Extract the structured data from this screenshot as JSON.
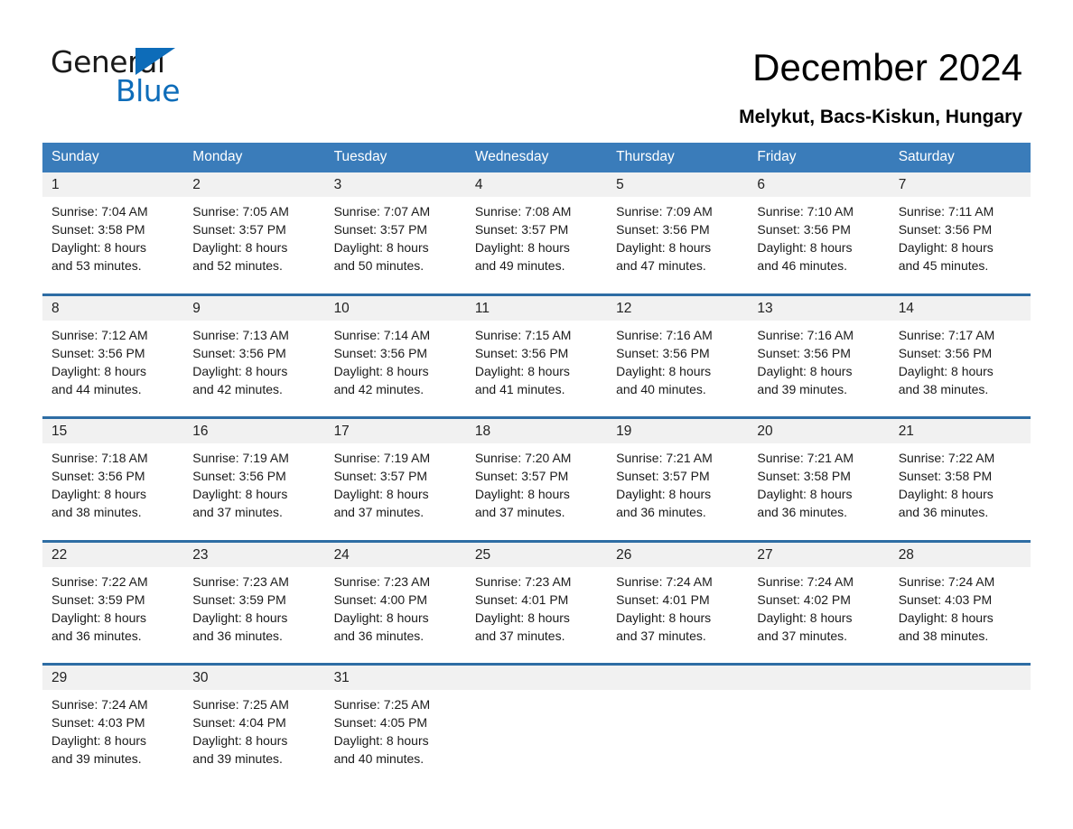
{
  "brand": {
    "name_part1": "General",
    "name_part2": "Blue",
    "accent_color": "#0d6cb9"
  },
  "header": {
    "title": "December 2024",
    "location": "Melykut, Bacs-Kiskun, Hungary"
  },
  "calendar": {
    "header_bg": "#3a7cba",
    "row_border_color": "#2e6da4",
    "daynum_bg": "#f1f1f1",
    "weekday_headers": [
      "Sunday",
      "Monday",
      "Tuesday",
      "Wednesday",
      "Thursday",
      "Friday",
      "Saturday"
    ],
    "weeks": [
      [
        {
          "day": "1",
          "sunrise": "Sunrise: 7:04 AM",
          "sunset": "Sunset: 3:58 PM",
          "daylight_line1": "Daylight: 8 hours",
          "daylight_line2": "and 53 minutes."
        },
        {
          "day": "2",
          "sunrise": "Sunrise: 7:05 AM",
          "sunset": "Sunset: 3:57 PM",
          "daylight_line1": "Daylight: 8 hours",
          "daylight_line2": "and 52 minutes."
        },
        {
          "day": "3",
          "sunrise": "Sunrise: 7:07 AM",
          "sunset": "Sunset: 3:57 PM",
          "daylight_line1": "Daylight: 8 hours",
          "daylight_line2": "and 50 minutes."
        },
        {
          "day": "4",
          "sunrise": "Sunrise: 7:08 AM",
          "sunset": "Sunset: 3:57 PM",
          "daylight_line1": "Daylight: 8 hours",
          "daylight_line2": "and 49 minutes."
        },
        {
          "day": "5",
          "sunrise": "Sunrise: 7:09 AM",
          "sunset": "Sunset: 3:56 PM",
          "daylight_line1": "Daylight: 8 hours",
          "daylight_line2": "and 47 minutes."
        },
        {
          "day": "6",
          "sunrise": "Sunrise: 7:10 AM",
          "sunset": "Sunset: 3:56 PM",
          "daylight_line1": "Daylight: 8 hours",
          "daylight_line2": "and 46 minutes."
        },
        {
          "day": "7",
          "sunrise": "Sunrise: 7:11 AM",
          "sunset": "Sunset: 3:56 PM",
          "daylight_line1": "Daylight: 8 hours",
          "daylight_line2": "and 45 minutes."
        }
      ],
      [
        {
          "day": "8",
          "sunrise": "Sunrise: 7:12 AM",
          "sunset": "Sunset: 3:56 PM",
          "daylight_line1": "Daylight: 8 hours",
          "daylight_line2": "and 44 minutes."
        },
        {
          "day": "9",
          "sunrise": "Sunrise: 7:13 AM",
          "sunset": "Sunset: 3:56 PM",
          "daylight_line1": "Daylight: 8 hours",
          "daylight_line2": "and 42 minutes."
        },
        {
          "day": "10",
          "sunrise": "Sunrise: 7:14 AM",
          "sunset": "Sunset: 3:56 PM",
          "daylight_line1": "Daylight: 8 hours",
          "daylight_line2": "and 42 minutes."
        },
        {
          "day": "11",
          "sunrise": "Sunrise: 7:15 AM",
          "sunset": "Sunset: 3:56 PM",
          "daylight_line1": "Daylight: 8 hours",
          "daylight_line2": "and 41 minutes."
        },
        {
          "day": "12",
          "sunrise": "Sunrise: 7:16 AM",
          "sunset": "Sunset: 3:56 PM",
          "daylight_line1": "Daylight: 8 hours",
          "daylight_line2": "and 40 minutes."
        },
        {
          "day": "13",
          "sunrise": "Sunrise: 7:16 AM",
          "sunset": "Sunset: 3:56 PM",
          "daylight_line1": "Daylight: 8 hours",
          "daylight_line2": "and 39 minutes."
        },
        {
          "day": "14",
          "sunrise": "Sunrise: 7:17 AM",
          "sunset": "Sunset: 3:56 PM",
          "daylight_line1": "Daylight: 8 hours",
          "daylight_line2": "and 38 minutes."
        }
      ],
      [
        {
          "day": "15",
          "sunrise": "Sunrise: 7:18 AM",
          "sunset": "Sunset: 3:56 PM",
          "daylight_line1": "Daylight: 8 hours",
          "daylight_line2": "and 38 minutes."
        },
        {
          "day": "16",
          "sunrise": "Sunrise: 7:19 AM",
          "sunset": "Sunset: 3:56 PM",
          "daylight_line1": "Daylight: 8 hours",
          "daylight_line2": "and 37 minutes."
        },
        {
          "day": "17",
          "sunrise": "Sunrise: 7:19 AM",
          "sunset": "Sunset: 3:57 PM",
          "daylight_line1": "Daylight: 8 hours",
          "daylight_line2": "and 37 minutes."
        },
        {
          "day": "18",
          "sunrise": "Sunrise: 7:20 AM",
          "sunset": "Sunset: 3:57 PM",
          "daylight_line1": "Daylight: 8 hours",
          "daylight_line2": "and 37 minutes."
        },
        {
          "day": "19",
          "sunrise": "Sunrise: 7:21 AM",
          "sunset": "Sunset: 3:57 PM",
          "daylight_line1": "Daylight: 8 hours",
          "daylight_line2": "and 36 minutes."
        },
        {
          "day": "20",
          "sunrise": "Sunrise: 7:21 AM",
          "sunset": "Sunset: 3:58 PM",
          "daylight_line1": "Daylight: 8 hours",
          "daylight_line2": "and 36 minutes."
        },
        {
          "day": "21",
          "sunrise": "Sunrise: 7:22 AM",
          "sunset": "Sunset: 3:58 PM",
          "daylight_line1": "Daylight: 8 hours",
          "daylight_line2": "and 36 minutes."
        }
      ],
      [
        {
          "day": "22",
          "sunrise": "Sunrise: 7:22 AM",
          "sunset": "Sunset: 3:59 PM",
          "daylight_line1": "Daylight: 8 hours",
          "daylight_line2": "and 36 minutes."
        },
        {
          "day": "23",
          "sunrise": "Sunrise: 7:23 AM",
          "sunset": "Sunset: 3:59 PM",
          "daylight_line1": "Daylight: 8 hours",
          "daylight_line2": "and 36 minutes."
        },
        {
          "day": "24",
          "sunrise": "Sunrise: 7:23 AM",
          "sunset": "Sunset: 4:00 PM",
          "daylight_line1": "Daylight: 8 hours",
          "daylight_line2": "and 36 minutes."
        },
        {
          "day": "25",
          "sunrise": "Sunrise: 7:23 AM",
          "sunset": "Sunset: 4:01 PM",
          "daylight_line1": "Daylight: 8 hours",
          "daylight_line2": "and 37 minutes."
        },
        {
          "day": "26",
          "sunrise": "Sunrise: 7:24 AM",
          "sunset": "Sunset: 4:01 PM",
          "daylight_line1": "Daylight: 8 hours",
          "daylight_line2": "and 37 minutes."
        },
        {
          "day": "27",
          "sunrise": "Sunrise: 7:24 AM",
          "sunset": "Sunset: 4:02 PM",
          "daylight_line1": "Daylight: 8 hours",
          "daylight_line2": "and 37 minutes."
        },
        {
          "day": "28",
          "sunrise": "Sunrise: 7:24 AM",
          "sunset": "Sunset: 4:03 PM",
          "daylight_line1": "Daylight: 8 hours",
          "daylight_line2": "and 38 minutes."
        }
      ],
      [
        {
          "day": "29",
          "sunrise": "Sunrise: 7:24 AM",
          "sunset": "Sunset: 4:03 PM",
          "daylight_line1": "Daylight: 8 hours",
          "daylight_line2": "and 39 minutes."
        },
        {
          "day": "30",
          "sunrise": "Sunrise: 7:25 AM",
          "sunset": "Sunset: 4:04 PM",
          "daylight_line1": "Daylight: 8 hours",
          "daylight_line2": "and 39 minutes."
        },
        {
          "day": "31",
          "sunrise": "Sunrise: 7:25 AM",
          "sunset": "Sunset: 4:05 PM",
          "daylight_line1": "Daylight: 8 hours",
          "daylight_line2": "and 40 minutes."
        },
        {
          "day": "",
          "sunrise": "",
          "sunset": "",
          "daylight_line1": "",
          "daylight_line2": ""
        },
        {
          "day": "",
          "sunrise": "",
          "sunset": "",
          "daylight_line1": "",
          "daylight_line2": ""
        },
        {
          "day": "",
          "sunrise": "",
          "sunset": "",
          "daylight_line1": "",
          "daylight_line2": ""
        },
        {
          "day": "",
          "sunrise": "",
          "sunset": "",
          "daylight_line1": "",
          "daylight_line2": ""
        }
      ]
    ]
  }
}
